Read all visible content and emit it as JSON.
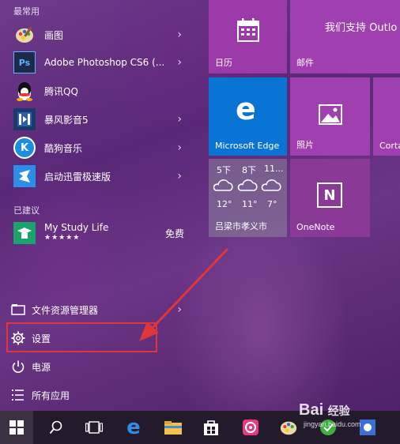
{
  "start_menu": {
    "most_used_label": "最常用",
    "suggested_label": "已建议",
    "apps": [
      {
        "label": "画图",
        "icon": "paint-icon",
        "has_submenu": true
      },
      {
        "label": "Adobe Photoshop CS6 (...",
        "icon": "photoshop-icon",
        "has_submenu": true
      },
      {
        "label": "腾讯QQ",
        "icon": "qq-icon",
        "has_submenu": false
      },
      {
        "label": "暴风影音5",
        "icon": "storm-player-icon",
        "has_submenu": true
      },
      {
        "label": "酷狗音乐",
        "icon": "kugou-icon",
        "has_submenu": true
      },
      {
        "label": "启动迅雷极速版",
        "icon": "thunder-icon",
        "has_submenu": true
      }
    ],
    "suggested_app": {
      "label": "My Study Life",
      "rating": "★★★★★",
      "price": "免费"
    },
    "photoshop_badge": "Ps",
    "kugou_badge": "K",
    "bottom": {
      "file_explorer": "文件资源管理器",
      "settings": "设置",
      "power": "电源",
      "all_apps": "所有应用"
    }
  },
  "tiles": {
    "calendar": {
      "label": "日历",
      "color": "#9b3aa8"
    },
    "mail": {
      "label": "邮件",
      "text": "我们支持 Outlo",
      "color": "#a03fb0"
    },
    "edge": {
      "label": "Microsoft Edge",
      "glyph": "e",
      "color": "#0a74d4"
    },
    "photos": {
      "label": "照片",
      "color": "#a03fb0"
    },
    "cortana": {
      "label": "Corta",
      "color": "#a03fb0"
    },
    "weather": {
      "label": "吕梁市孝义市",
      "color": "rgba(160,160,170,0.45)",
      "days": [
        {
          "time": "5下",
          "temp": "12°"
        },
        {
          "time": "8下",
          "temp": "11°"
        },
        {
          "time": "11...",
          "temp": "7°"
        }
      ]
    },
    "onenote": {
      "label": "OneNote",
      "badge": "N",
      "color": "#8a3a96"
    }
  },
  "annotation": {
    "color": "#e0363b"
  },
  "watermark": {
    "brand": "Bai",
    "brand2": "经验",
    "url": "jingyan.baidu.com"
  }
}
